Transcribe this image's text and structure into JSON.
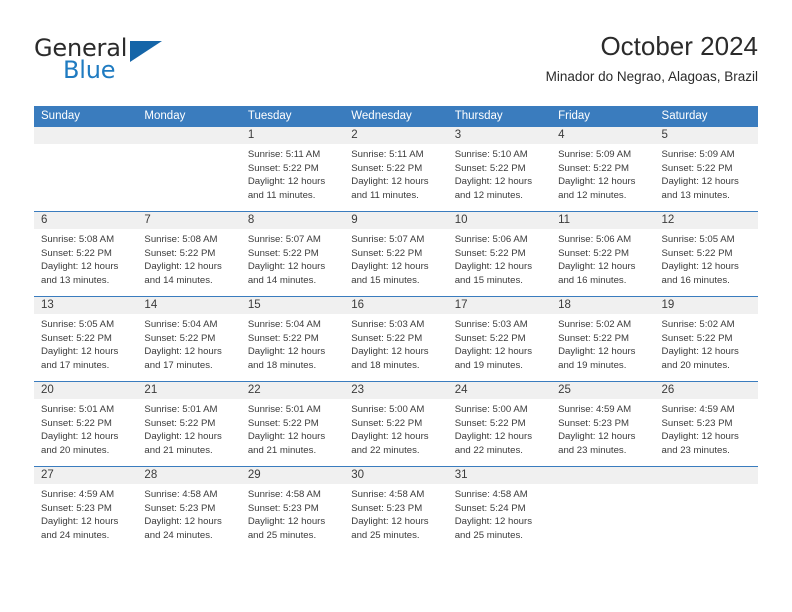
{
  "brand": {
    "name_part1": "General",
    "name_part2": "Blue",
    "triangle_icon": "triangle-icon",
    "accent_color": "#1f7bc1",
    "header_color": "#3a7cbe"
  },
  "header": {
    "title": "October 2024",
    "subtitle": "Minador do Negrao, Alagoas, Brazil"
  },
  "calendar": {
    "weekday_headers": [
      "Sunday",
      "Monday",
      "Tuesday",
      "Wednesday",
      "Thursday",
      "Friday",
      "Saturday"
    ],
    "weeks": [
      [
        {
          "day": "",
          "empty": true
        },
        {
          "day": "",
          "empty": true
        },
        {
          "day": "1",
          "sunrise": "Sunrise: 5:11 AM",
          "sunset": "Sunset: 5:22 PM",
          "daylight": "Daylight: 12 hours and 11 minutes."
        },
        {
          "day": "2",
          "sunrise": "Sunrise: 5:11 AM",
          "sunset": "Sunset: 5:22 PM",
          "daylight": "Daylight: 12 hours and 11 minutes."
        },
        {
          "day": "3",
          "sunrise": "Sunrise: 5:10 AM",
          "sunset": "Sunset: 5:22 PM",
          "daylight": "Daylight: 12 hours and 12 minutes."
        },
        {
          "day": "4",
          "sunrise": "Sunrise: 5:09 AM",
          "sunset": "Sunset: 5:22 PM",
          "daylight": "Daylight: 12 hours and 12 minutes."
        },
        {
          "day": "5",
          "sunrise": "Sunrise: 5:09 AM",
          "sunset": "Sunset: 5:22 PM",
          "daylight": "Daylight: 12 hours and 13 minutes."
        }
      ],
      [
        {
          "day": "6",
          "sunrise": "Sunrise: 5:08 AM",
          "sunset": "Sunset: 5:22 PM",
          "daylight": "Daylight: 12 hours and 13 minutes."
        },
        {
          "day": "7",
          "sunrise": "Sunrise: 5:08 AM",
          "sunset": "Sunset: 5:22 PM",
          "daylight": "Daylight: 12 hours and 14 minutes."
        },
        {
          "day": "8",
          "sunrise": "Sunrise: 5:07 AM",
          "sunset": "Sunset: 5:22 PM",
          "daylight": "Daylight: 12 hours and 14 minutes."
        },
        {
          "day": "9",
          "sunrise": "Sunrise: 5:07 AM",
          "sunset": "Sunset: 5:22 PM",
          "daylight": "Daylight: 12 hours and 15 minutes."
        },
        {
          "day": "10",
          "sunrise": "Sunrise: 5:06 AM",
          "sunset": "Sunset: 5:22 PM",
          "daylight": "Daylight: 12 hours and 15 minutes."
        },
        {
          "day": "11",
          "sunrise": "Sunrise: 5:06 AM",
          "sunset": "Sunset: 5:22 PM",
          "daylight": "Daylight: 12 hours and 16 minutes."
        },
        {
          "day": "12",
          "sunrise": "Sunrise: 5:05 AM",
          "sunset": "Sunset: 5:22 PM",
          "daylight": "Daylight: 12 hours and 16 minutes."
        }
      ],
      [
        {
          "day": "13",
          "sunrise": "Sunrise: 5:05 AM",
          "sunset": "Sunset: 5:22 PM",
          "daylight": "Daylight: 12 hours and 17 minutes."
        },
        {
          "day": "14",
          "sunrise": "Sunrise: 5:04 AM",
          "sunset": "Sunset: 5:22 PM",
          "daylight": "Daylight: 12 hours and 17 minutes."
        },
        {
          "day": "15",
          "sunrise": "Sunrise: 5:04 AM",
          "sunset": "Sunset: 5:22 PM",
          "daylight": "Daylight: 12 hours and 18 minutes."
        },
        {
          "day": "16",
          "sunrise": "Sunrise: 5:03 AM",
          "sunset": "Sunset: 5:22 PM",
          "daylight": "Daylight: 12 hours and 18 minutes."
        },
        {
          "day": "17",
          "sunrise": "Sunrise: 5:03 AM",
          "sunset": "Sunset: 5:22 PM",
          "daylight": "Daylight: 12 hours and 19 minutes."
        },
        {
          "day": "18",
          "sunrise": "Sunrise: 5:02 AM",
          "sunset": "Sunset: 5:22 PM",
          "daylight": "Daylight: 12 hours and 19 minutes."
        },
        {
          "day": "19",
          "sunrise": "Sunrise: 5:02 AM",
          "sunset": "Sunset: 5:22 PM",
          "daylight": "Daylight: 12 hours and 20 minutes."
        }
      ],
      [
        {
          "day": "20",
          "sunrise": "Sunrise: 5:01 AM",
          "sunset": "Sunset: 5:22 PM",
          "daylight": "Daylight: 12 hours and 20 minutes."
        },
        {
          "day": "21",
          "sunrise": "Sunrise: 5:01 AM",
          "sunset": "Sunset: 5:22 PM",
          "daylight": "Daylight: 12 hours and 21 minutes."
        },
        {
          "day": "22",
          "sunrise": "Sunrise: 5:01 AM",
          "sunset": "Sunset: 5:22 PM",
          "daylight": "Daylight: 12 hours and 21 minutes."
        },
        {
          "day": "23",
          "sunrise": "Sunrise: 5:00 AM",
          "sunset": "Sunset: 5:22 PM",
          "daylight": "Daylight: 12 hours and 22 minutes."
        },
        {
          "day": "24",
          "sunrise": "Sunrise: 5:00 AM",
          "sunset": "Sunset: 5:22 PM",
          "daylight": "Daylight: 12 hours and 22 minutes."
        },
        {
          "day": "25",
          "sunrise": "Sunrise: 4:59 AM",
          "sunset": "Sunset: 5:23 PM",
          "daylight": "Daylight: 12 hours and 23 minutes."
        },
        {
          "day": "26",
          "sunrise": "Sunrise: 4:59 AM",
          "sunset": "Sunset: 5:23 PM",
          "daylight": "Daylight: 12 hours and 23 minutes."
        }
      ],
      [
        {
          "day": "27",
          "sunrise": "Sunrise: 4:59 AM",
          "sunset": "Sunset: 5:23 PM",
          "daylight": "Daylight: 12 hours and 24 minutes."
        },
        {
          "day": "28",
          "sunrise": "Sunrise: 4:58 AM",
          "sunset": "Sunset: 5:23 PM",
          "daylight": "Daylight: 12 hours and 24 minutes."
        },
        {
          "day": "29",
          "sunrise": "Sunrise: 4:58 AM",
          "sunset": "Sunset: 5:23 PM",
          "daylight": "Daylight: 12 hours and 25 minutes."
        },
        {
          "day": "30",
          "sunrise": "Sunrise: 4:58 AM",
          "sunset": "Sunset: 5:23 PM",
          "daylight": "Daylight: 12 hours and 25 minutes."
        },
        {
          "day": "31",
          "sunrise": "Sunrise: 4:58 AM",
          "sunset": "Sunset: 5:24 PM",
          "daylight": "Daylight: 12 hours and 25 minutes."
        },
        {
          "day": "",
          "empty": true
        },
        {
          "day": "",
          "empty": true
        }
      ]
    ]
  }
}
